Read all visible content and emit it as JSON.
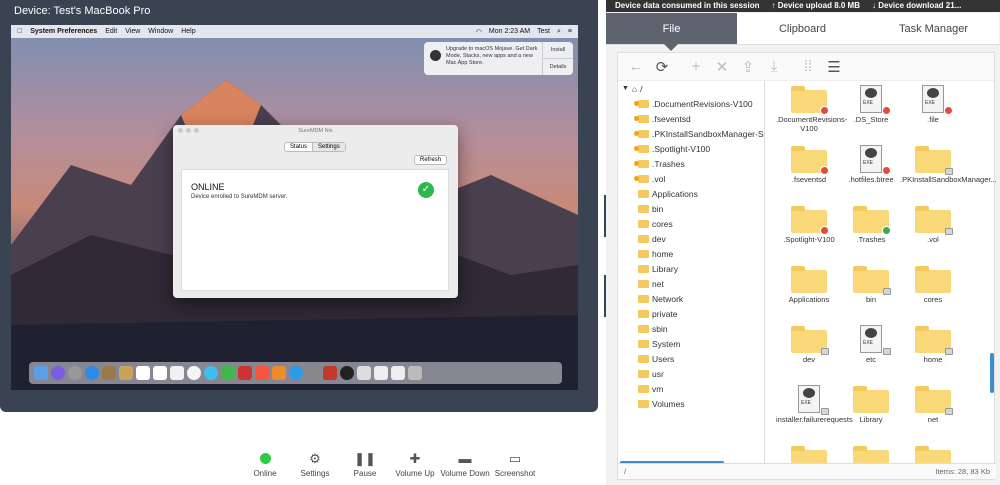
{
  "device": {
    "title": "Device: Test's MacBook Pro"
  },
  "mac": {
    "menu": [
      "System Preferences",
      "Edit",
      "View",
      "Window",
      "Help"
    ],
    "status_time": "Mon 2:23 AM",
    "status_user": "Test",
    "notification": {
      "text": "Upgrade to macOS Mojave. Get Dark Mode, Stacks, new apps and a new Mac App Store.",
      "install": "Install",
      "details": "Details"
    }
  },
  "app": {
    "title": "SureMDM Nix",
    "tabs": [
      "Status",
      "Settings"
    ],
    "refresh": "Refresh",
    "status": "ONLINE",
    "message": "Device enrolled to SureMDM server."
  },
  "toolbar": [
    {
      "label": "Online",
      "icon": "online-dot-icon"
    },
    {
      "label": "Settings",
      "icon": "gear-icon"
    },
    {
      "label": "Pause",
      "icon": "pause-icon"
    },
    {
      "label": "Volume Up",
      "icon": "plus-icon"
    },
    {
      "label": "Volume Down",
      "icon": "minus-icon"
    },
    {
      "label": "Screenshot",
      "icon": "monitor-icon"
    }
  ],
  "stats": {
    "consumed": "Device data consumed in this session",
    "upload": "Device upload 8.0 MB",
    "download": "Device download 21..."
  },
  "tabs": [
    "File",
    "Clipboard",
    "Task Manager"
  ],
  "tree": {
    "root": "/",
    "items": [
      ".DocumentRevisions-V100",
      ".fseventsd",
      ".PKInstallSandboxManager-S",
      ".Spotlight-V100",
      ".Trashes",
      ".vol",
      "Applications",
      "bin",
      "cores",
      "dev",
      "home",
      "Library",
      "net",
      "Network",
      "private",
      "sbin",
      "System",
      "Users",
      "usr",
      "vm",
      "Volumes"
    ]
  },
  "grid": {
    "items": [
      {
        "name": ".DocumentRevisions-V100",
        "kind": "folder",
        "badge": "red"
      },
      {
        "name": ".DS_Store",
        "kind": "file",
        "badge": "red"
      },
      {
        "name": ".file",
        "kind": "file",
        "badge": "red"
      },
      {
        "name": ".fseventsd",
        "kind": "folder",
        "badge": "red"
      },
      {
        "name": ".hotfiles.btree",
        "kind": "file",
        "badge": "red"
      },
      {
        "name": ".PKInstallSandboxManager...are",
        "kind": "folder",
        "badge": "lock"
      },
      {
        "name": ".Spotlight-V100",
        "kind": "folder",
        "badge": "red"
      },
      {
        "name": ".Trashes",
        "kind": "folder",
        "badge": "green"
      },
      {
        "name": ".vol",
        "kind": "folder",
        "badge": "lock"
      },
      {
        "name": "Applications",
        "kind": "folder",
        "badge": ""
      },
      {
        "name": "bin",
        "kind": "folder",
        "badge": "lock"
      },
      {
        "name": "cores",
        "kind": "folder",
        "badge": ""
      },
      {
        "name": "dev",
        "kind": "folder",
        "badge": "lock"
      },
      {
        "name": "etc",
        "kind": "file",
        "badge": "lock"
      },
      {
        "name": "home",
        "kind": "folder",
        "badge": "lock"
      },
      {
        "name": "installer.failurerequests",
        "kind": "file",
        "badge": "lock"
      },
      {
        "name": "Library",
        "kind": "folder",
        "badge": ""
      },
      {
        "name": "net",
        "kind": "folder",
        "badge": "lock"
      }
    ]
  },
  "status_bar": {
    "path": "/",
    "count": "Items: 28, 83 Kb"
  }
}
